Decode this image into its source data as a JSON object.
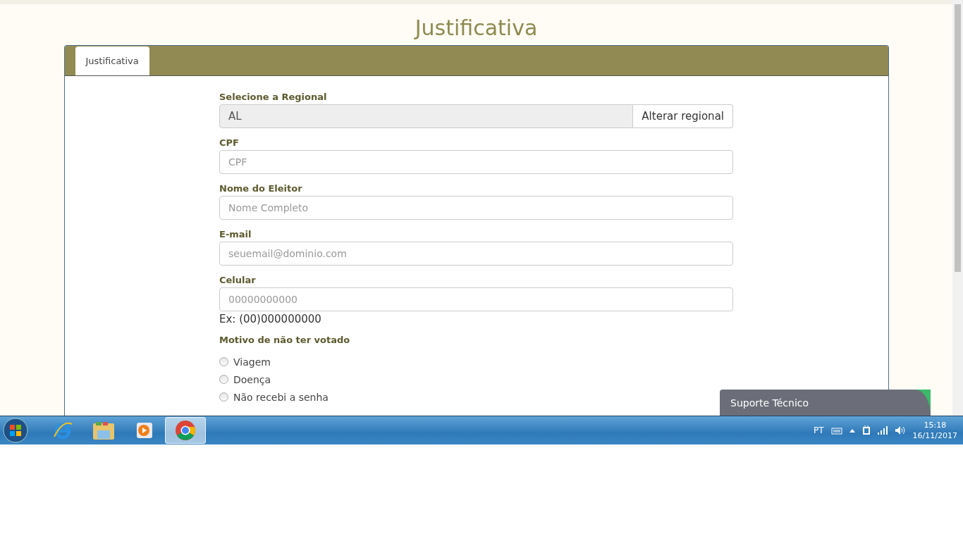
{
  "page": {
    "title": "Justificativa"
  },
  "tabs": [
    {
      "label": "Justificativa",
      "selected": true
    }
  ],
  "form": {
    "regional": {
      "label": "Selecione a Regional",
      "value": "AL",
      "button": "Alterar regional"
    },
    "fields": [
      {
        "label": "CPF",
        "placeholder": "CPF"
      },
      {
        "label": "Nome do Eleitor",
        "placeholder": "Nome Completo"
      },
      {
        "label": "E-mail",
        "placeholder": "seuemail@dominio.com"
      },
      {
        "label": "Celular",
        "placeholder": "00000000000",
        "hint": "Ex: (00)000000000"
      }
    ],
    "reason": {
      "label": "Motivo de não ter votado",
      "options": [
        {
          "label": "Viagem",
          "selected": false
        },
        {
          "label": "Doença",
          "selected": false
        },
        {
          "label": "Não recebi a senha",
          "selected": false
        }
      ]
    }
  },
  "support_widget": {
    "label": "Suporte Técnico"
  },
  "taskbar": {
    "apps": [
      {
        "kind": "ie",
        "selected": false
      },
      {
        "kind": "folder",
        "selected": false
      },
      {
        "kind": "media",
        "selected": false
      },
      {
        "kind": "chrome",
        "selected": true
      }
    ],
    "language": "PT",
    "time": "15:18",
    "date": "16/11/2017"
  }
}
